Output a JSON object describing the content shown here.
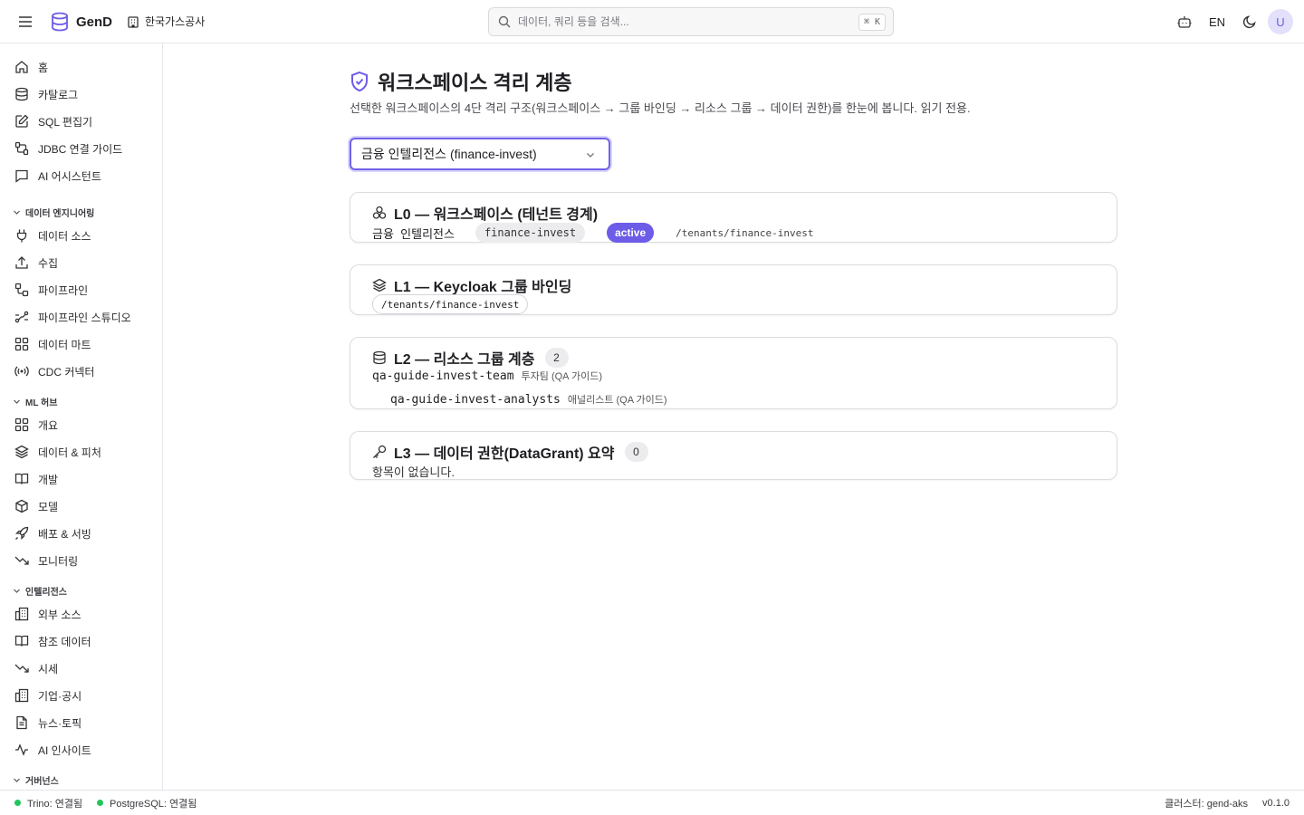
{
  "app": {
    "brand": "GenD",
    "org": "한국가스공사"
  },
  "search": {
    "placeholder": "데이터, 쿼리 등을 검색...",
    "shortcut": "⌘ K"
  },
  "topbar": {
    "lang": "EN",
    "avatar": "U"
  },
  "sidebar": {
    "top_items": [
      {
        "label": "홈",
        "icon": "home-icon"
      },
      {
        "label": "카탈로그",
        "icon": "database-icon"
      },
      {
        "label": "SQL 편집기",
        "icon": "edit-icon"
      },
      {
        "label": "JDBC 연결 가이드",
        "icon": "connection-icon"
      },
      {
        "label": "AI 어시스턴트",
        "icon": "chat-icon"
      }
    ],
    "sections": [
      {
        "title": "데이터 엔지니어링",
        "items": [
          {
            "label": "데이터 소스",
            "icon": "plug-icon"
          },
          {
            "label": "수집",
            "icon": "upload-icon"
          },
          {
            "label": "파이프라인",
            "icon": "pipeline-icon"
          },
          {
            "label": "파이프라인 스튜디오",
            "icon": "workflow-icon"
          },
          {
            "label": "데이터 마트",
            "icon": "grid-icon"
          },
          {
            "label": "CDC 커넥터",
            "icon": "broadcast-icon"
          }
        ]
      },
      {
        "title": "ML 허브",
        "items": [
          {
            "label": "개요",
            "icon": "grid-icon"
          },
          {
            "label": "데이터 & 피처",
            "icon": "layers-icon"
          },
          {
            "label": "개발",
            "icon": "book-icon"
          },
          {
            "label": "모델",
            "icon": "box-icon"
          },
          {
            "label": "배포 & 서빙",
            "icon": "rocket-icon"
          },
          {
            "label": "모니터링",
            "icon": "trend-down-icon"
          }
        ]
      },
      {
        "title": "인텔리전스",
        "items": [
          {
            "label": "외부 소스",
            "icon": "building-icon"
          },
          {
            "label": "참조 데이터",
            "icon": "book-icon"
          },
          {
            "label": "시세",
            "icon": "trend-down-icon"
          },
          {
            "label": "기업·공시",
            "icon": "building-icon"
          },
          {
            "label": "뉴스·토픽",
            "icon": "document-icon"
          },
          {
            "label": "AI 인사이트",
            "icon": "activity-icon"
          }
        ]
      },
      {
        "title": "거버넌스",
        "items": []
      }
    ]
  },
  "page": {
    "title": "워크스페이스 격리 계층",
    "subtitle": "선택한 워크스페이스의 4단 격리 구조(워크스페이스 → 그룹 바인딩 → 리소스 그룹 → 데이터 권한)를 한눈에 봅니다. 읽기 전용.",
    "workspace_select": "금융 인텔리전스 (finance-invest)"
  },
  "levels": {
    "l0": {
      "title": "L0 — 워크스페이스 (테넌트 경계)",
      "name": "금융  인텔리전스",
      "slug": "finance-invest",
      "status": "active",
      "path": "/tenants/finance-invest"
    },
    "l1": {
      "title": "L1 — Keycloak 그룹 바인딩",
      "group": "/tenants/finance-invest"
    },
    "l2": {
      "title": "L2 — 리소스 그룹 계층",
      "count": "2",
      "groups": [
        {
          "name": "qa-guide-invest-team",
          "desc": "투자팀 (QA 가이드)"
        },
        {
          "name": "qa-guide-invest-analysts",
          "desc": "애널리스트 (QA 가이드)"
        }
      ]
    },
    "l3": {
      "title": "L3 — 데이터 권한(DataGrant) 요약",
      "count": "0",
      "empty": "항목이 없습니다."
    }
  },
  "status": {
    "trino": "Trino: 연결됨",
    "postgres": "PostgreSQL: 연결됨",
    "cluster": "클러스터: gend-aks",
    "version": "v0.1.0"
  },
  "colors": {
    "accent": "#6c5ce7",
    "ok": "#22c55e"
  }
}
